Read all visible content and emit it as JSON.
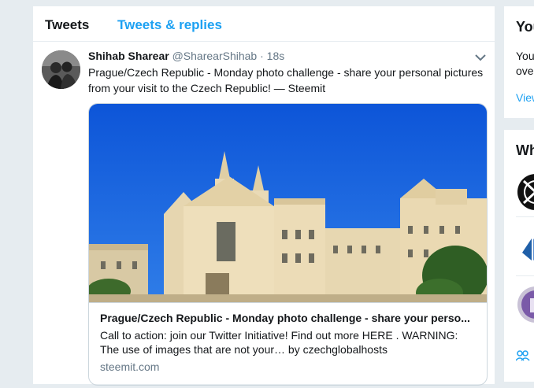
{
  "tabs": {
    "tweets": "Tweets",
    "replies": "Tweets & replies"
  },
  "tweet": {
    "fullname": "Shihab Sharear",
    "handle": "@SharearShihab",
    "dot": "·",
    "time": "18s",
    "text": "Prague/Czech Republic - Monday photo challenge - share your personal pictures from your visit to the Czech Republic! — Steemit",
    "card": {
      "title": "Prague/Czech Republic - Monday photo challenge - share your perso...",
      "description": "Call to action: join our Twitter Initiative! Find out more HERE . WARNING: The use of images that are not your… by czechglobalhosts",
      "domain": "steemit.com"
    }
  },
  "right": {
    "panel1_title": "You",
    "panel1_line1": "You",
    "panel1_line2": "ove",
    "panel1_link": "View",
    "panel2_title": "Wh"
  },
  "colors": {
    "accent": "#1da1f2",
    "background": "#e6ecf0",
    "text": "#14171a",
    "muted": "#657786"
  },
  "icons": {
    "caret": "chevron-down-icon",
    "people": "people-icon"
  }
}
